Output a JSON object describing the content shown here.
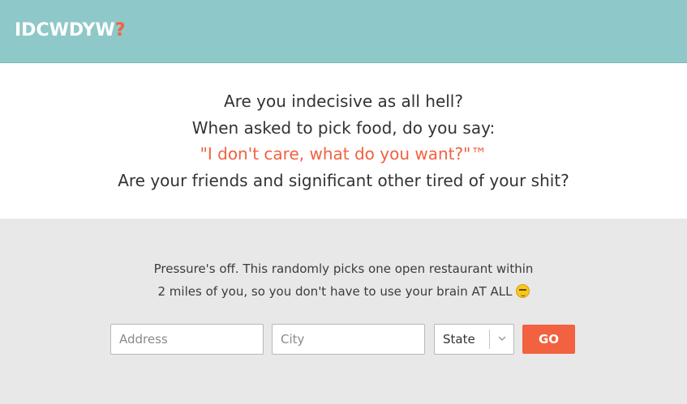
{
  "header": {
    "logo_text": "IDCWDYW",
    "logo_mark": "?"
  },
  "hero": {
    "lines": [
      "Are you indecisive as all hell?",
      "When asked to pick food, do you say:",
      "\"I don't care, what do you want?\"™",
      "Are your friends and significant other tired of your shit?"
    ]
  },
  "search": {
    "description_line1": "Pressure's off. This randomly picks one open restaurant within",
    "description_line2": "2 miles of you, so you don't have to use your brain AT ALL",
    "emoji": "smirk-emoji-icon",
    "address_placeholder": "Address",
    "address_value": "",
    "city_placeholder": "City",
    "city_value": "",
    "state_selected": "State",
    "go_label": "GO"
  },
  "colors": {
    "header_bg": "#8ec8c8",
    "accent": "#f26140",
    "panel_bg": "#e8e8e8",
    "text": "#333333"
  }
}
